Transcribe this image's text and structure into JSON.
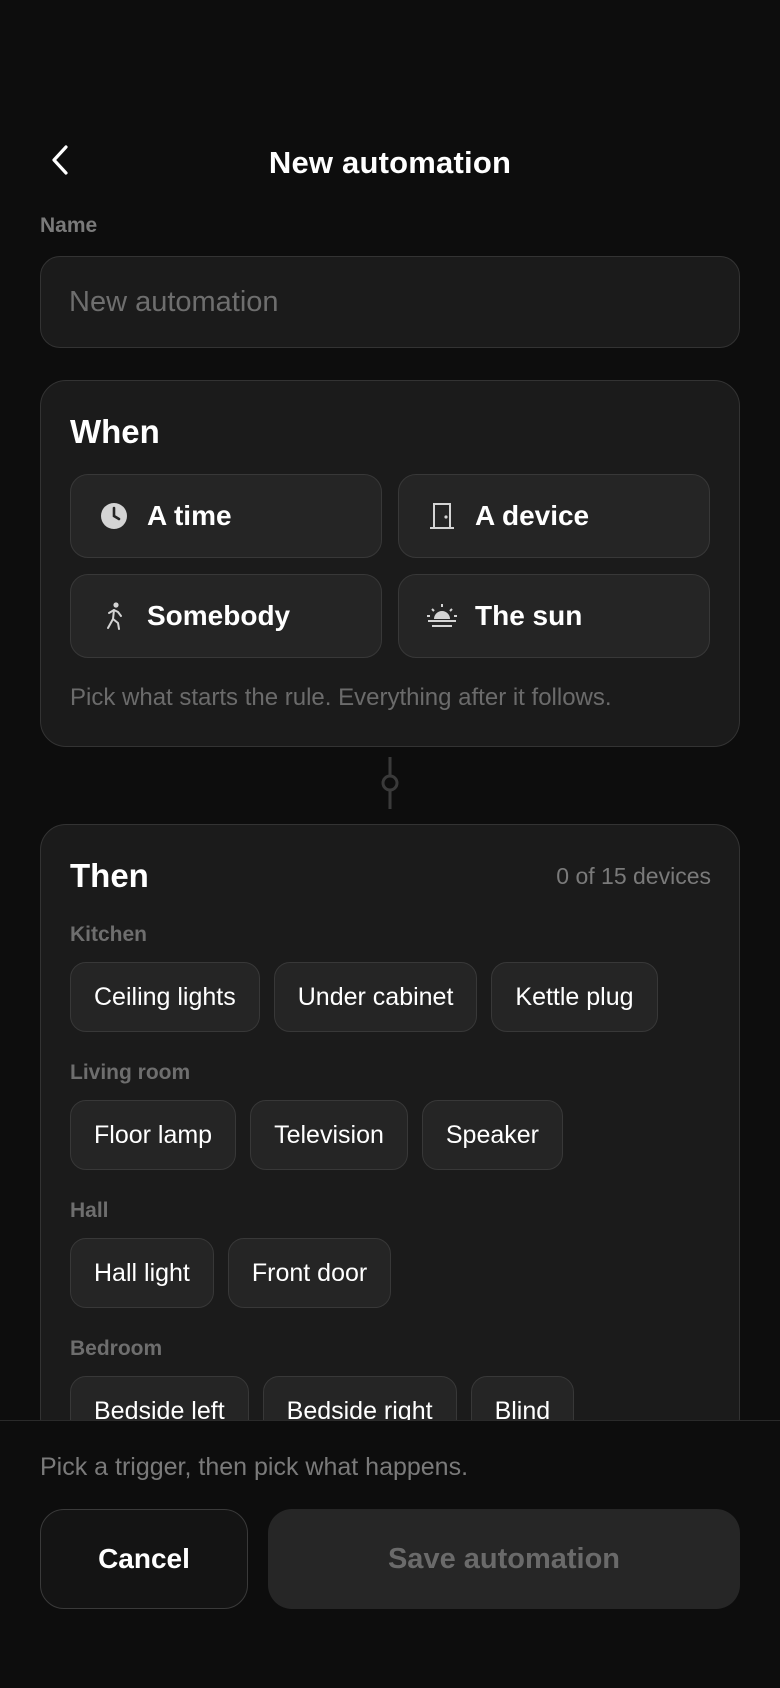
{
  "header": {
    "title": "New automation"
  },
  "name_field": {
    "label": "Name",
    "value": "",
    "placeholder": "New automation"
  },
  "when": {
    "title": "When",
    "triggers": [
      {
        "label": "A time",
        "icon": "clock-icon"
      },
      {
        "label": "A device",
        "icon": "door-icon"
      },
      {
        "label": "Somebody",
        "icon": "person-walking-icon"
      },
      {
        "label": "The sun",
        "icon": "sunrise-icon"
      }
    ],
    "hint": "Pick what starts the rule. Everything after it follows."
  },
  "then": {
    "title": "Then",
    "count": "0 of 15 devices",
    "rooms": [
      {
        "name": "Kitchen",
        "devices": [
          "Ceiling lights",
          "Under cabinet",
          "Kettle plug"
        ]
      },
      {
        "name": "Living room",
        "devices": [
          "Floor lamp",
          "Television",
          "Speaker"
        ]
      },
      {
        "name": "Hall",
        "devices": [
          "Hall light",
          "Front door"
        ]
      },
      {
        "name": "Bedroom",
        "devices": [
          "Bedside left",
          "Bedside right",
          "Blind"
        ]
      }
    ]
  },
  "footer": {
    "hint": "Pick a trigger, then pick what happens.",
    "cancel_label": "Cancel",
    "save_label": "Save automation"
  }
}
